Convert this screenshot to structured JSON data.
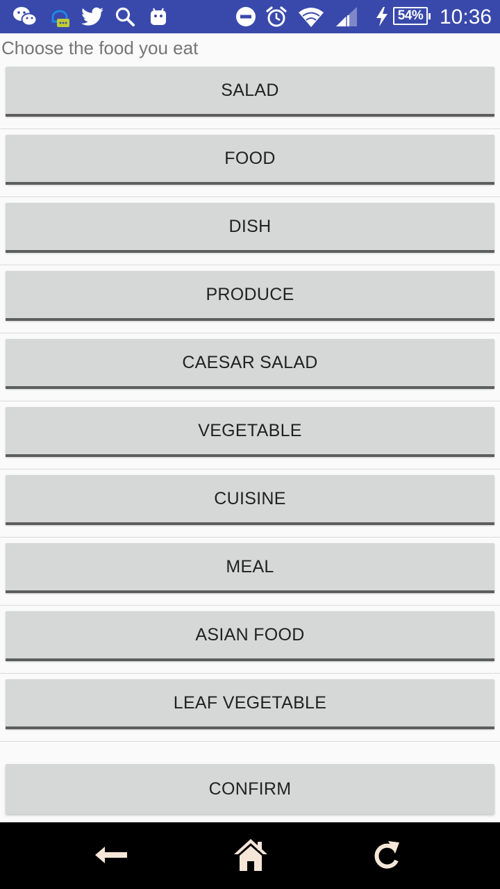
{
  "status_bar": {
    "icons_left": [
      "wechat-icon",
      "notification-bot-icon",
      "twitter-icon",
      "search-icon",
      "android-icon"
    ],
    "icons_right": [
      "do-not-disturb-icon",
      "alarm-icon",
      "wifi-icon",
      "cell-signal-icon",
      "charging-icon"
    ],
    "battery_percent": "54%",
    "time": "10:36",
    "background": "#3949ab"
  },
  "prompt": "Choose the food you eat",
  "food_options": [
    {
      "label": "SALAD"
    },
    {
      "label": "FOOD"
    },
    {
      "label": "DISH"
    },
    {
      "label": "PRODUCE"
    },
    {
      "label": "CAESAR SALAD"
    },
    {
      "label": "VEGETABLE"
    },
    {
      "label": "CUISINE"
    },
    {
      "label": "MEAL"
    },
    {
      "label": "ASIAN FOOD"
    },
    {
      "label": "LEAF VEGETABLE"
    }
  ],
  "confirm_label": "CONFIRM",
  "nav_bar": {
    "icons": [
      "back-icon",
      "home-icon",
      "refresh-icon"
    ],
    "icon_color": "#f5e6d8"
  }
}
